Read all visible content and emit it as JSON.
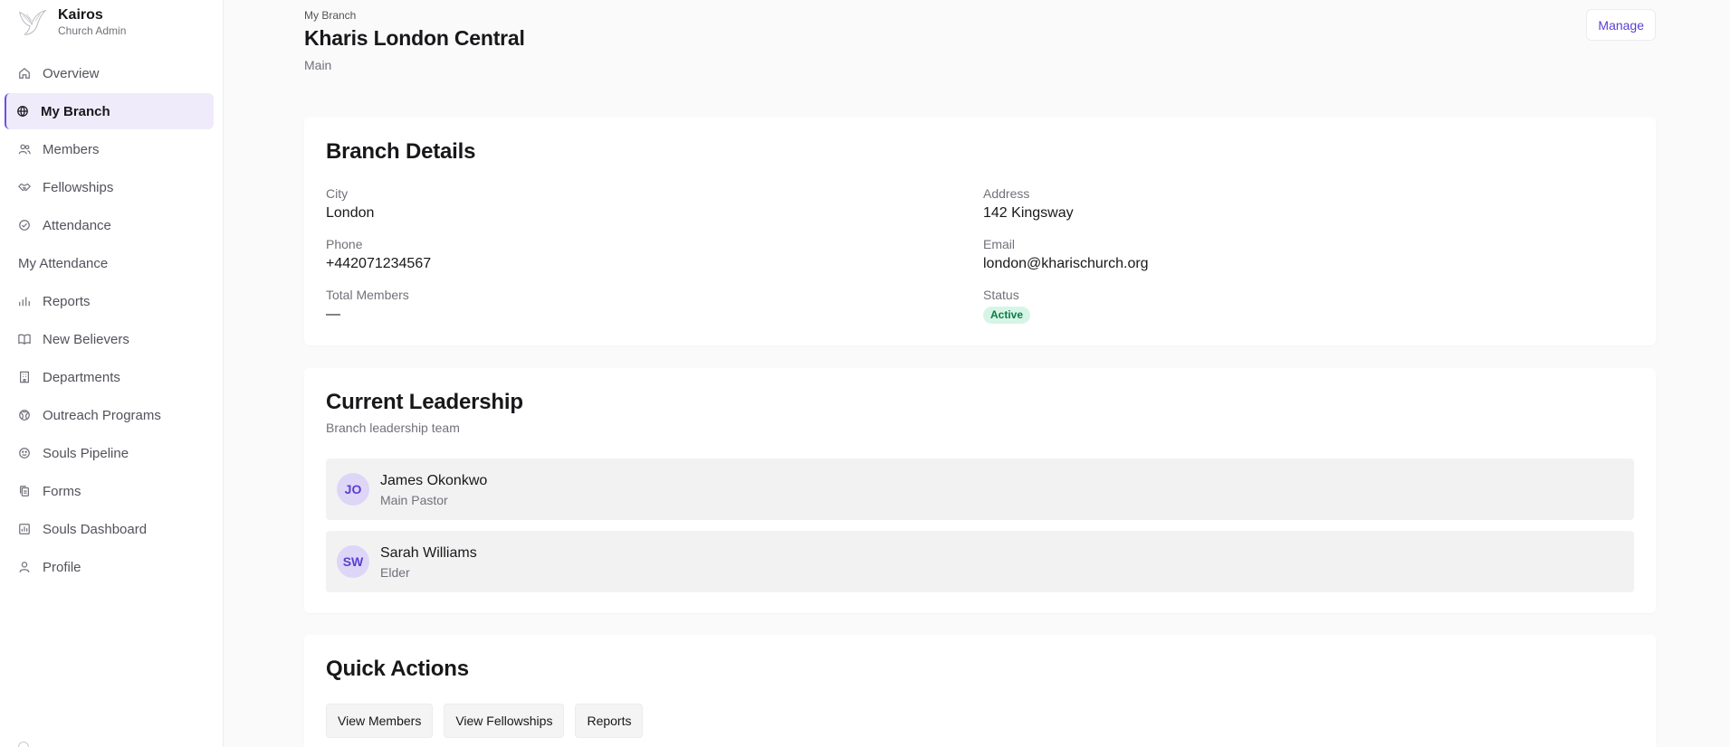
{
  "brand": {
    "title": "Kairos",
    "subtitle": "Church Admin",
    "logo_icon": "dove-logo-icon"
  },
  "sidebar": {
    "items": [
      {
        "label": "Overview",
        "icon": "home-icon"
      },
      {
        "label": "My Branch",
        "icon": "globe-icon",
        "active": true
      },
      {
        "label": "Members",
        "icon": "users-icon"
      },
      {
        "label": "Fellowships",
        "icon": "handshake-icon"
      },
      {
        "label": "Attendance",
        "icon": "check-circle-icon"
      },
      {
        "label": "My Attendance",
        "icon": ""
      },
      {
        "label": "Reports",
        "icon": "bar-chart-icon"
      },
      {
        "label": "New Believers",
        "icon": "book-open-icon"
      },
      {
        "label": "Departments",
        "icon": "building-icon"
      },
      {
        "label": "Outreach Programs",
        "icon": "globe-alt-icon"
      },
      {
        "label": "Souls Pipeline",
        "icon": "smile-icon"
      },
      {
        "label": "Forms",
        "icon": "copy-icon"
      },
      {
        "label": "Souls Dashboard",
        "icon": "chart-square-icon"
      },
      {
        "label": "Profile",
        "icon": "user-icon"
      }
    ],
    "accent": "#6d4fe0"
  },
  "header": {
    "breadcrumb": "My Branch",
    "title": "Kharis London Central",
    "subtitle": "Main",
    "manage_label": "Manage"
  },
  "details": {
    "title": "Branch Details",
    "fields": [
      {
        "label": "City",
        "value": "London"
      },
      {
        "label": "Address",
        "value": "142 Kingsway"
      },
      {
        "label": "Phone",
        "value": "+442071234567"
      },
      {
        "label": "Email",
        "value": "london@kharischurch.org"
      },
      {
        "label": "Total Members",
        "value": "—"
      },
      {
        "label": "Status",
        "value": "Active"
      }
    ]
  },
  "leadership": {
    "title": "Current Leadership",
    "description": "Branch leadership team",
    "leaders": [
      {
        "initials": "JO",
        "name": "James Okonkwo",
        "role": "Main Pastor"
      },
      {
        "initials": "SW",
        "name": "Sarah Williams",
        "role": "Elder"
      }
    ]
  },
  "quick_actions": {
    "title": "Quick Actions",
    "buttons": [
      "View Members",
      "View Fellowships",
      "Reports"
    ]
  },
  "colors": {
    "accent": "#5b3fd1",
    "active_badge_bg": "#d7f5e6",
    "active_badge_text": "#0d7a48"
  }
}
